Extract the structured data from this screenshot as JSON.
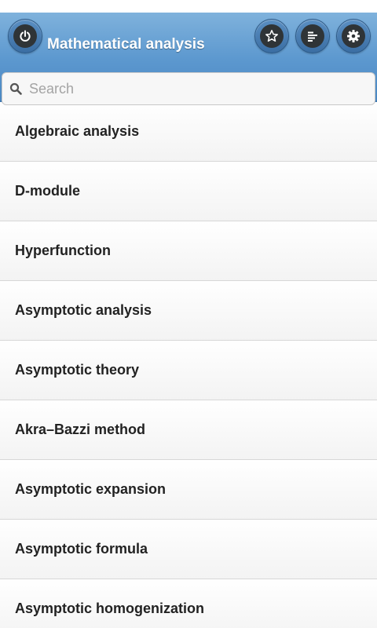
{
  "header": {
    "title": "Mathematical analysis",
    "power_icon": "power-icon",
    "favorites_icon": "star-icon",
    "list_icon": "list-icon",
    "settings_icon": "gear-icon"
  },
  "search": {
    "placeholder": "Search",
    "value": "",
    "icon": "search-icon"
  },
  "list": {
    "items": [
      {
        "label": "Algebraic analysis"
      },
      {
        "label": "D-module"
      },
      {
        "label": "Hyperfunction"
      },
      {
        "label": "Asymptotic analysis"
      },
      {
        "label": "Asymptotic theory"
      },
      {
        "label": "Akra–Bazzi method"
      },
      {
        "label": "Asymptotic expansion"
      },
      {
        "label": "Asymptotic formula"
      },
      {
        "label": "Asymptotic homogenization"
      }
    ]
  },
  "colors": {
    "header_top": "#7fb2dc",
    "header_bottom": "#4a87c2",
    "button_inner": "#2f3437",
    "item_text": "#222222"
  }
}
